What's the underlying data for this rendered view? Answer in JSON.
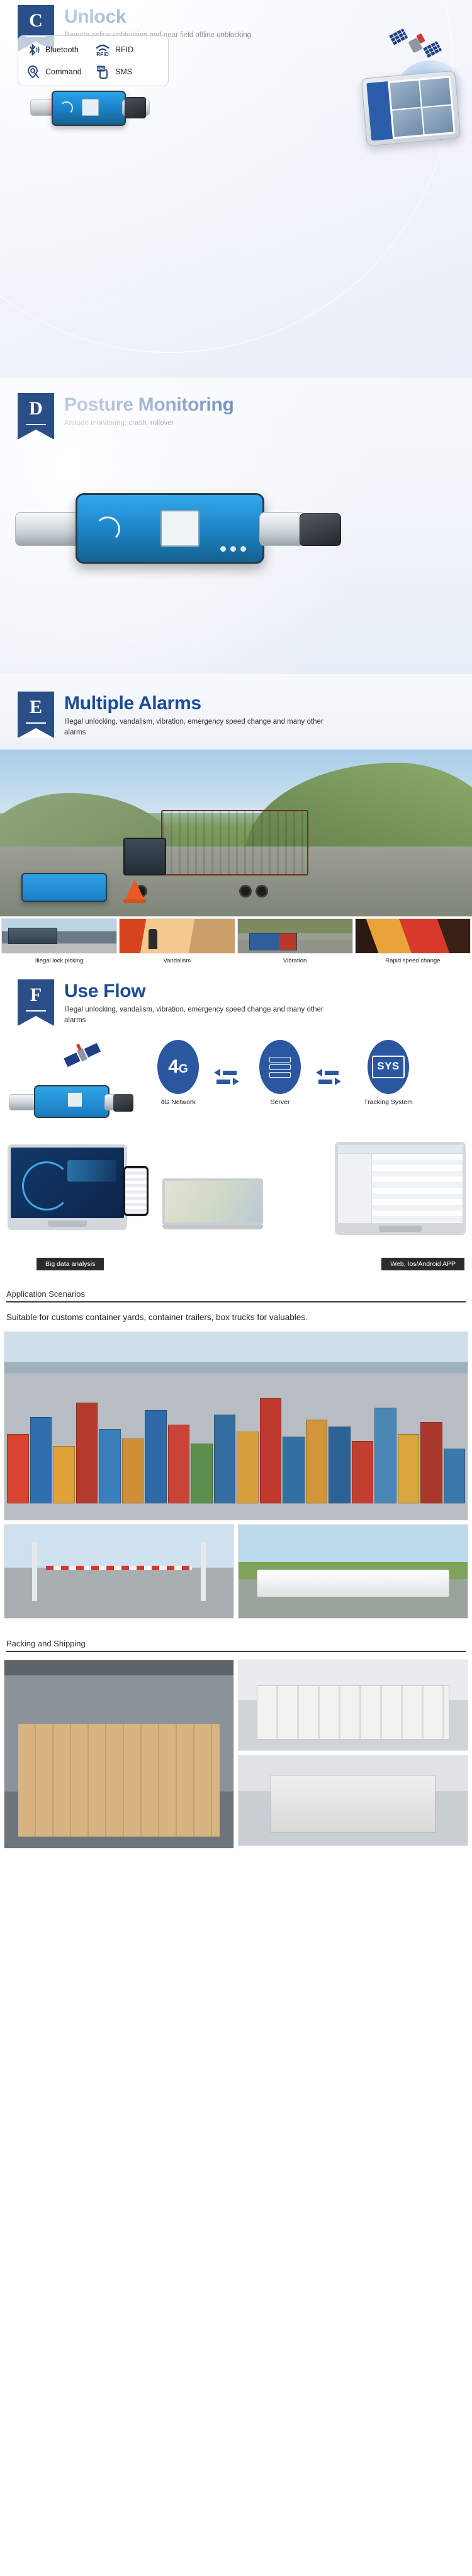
{
  "sections": {
    "unlock": {
      "badge": "C",
      "title": "Unlock",
      "subtitle": "Remote online unblocking and near field offline unblocking",
      "methods": [
        {
          "label": "Bluetooth",
          "icon": "bluetooth-icon"
        },
        {
          "label": "RFID",
          "icon": "rfid-icon"
        },
        {
          "label": "Command",
          "icon": "location-command-icon"
        },
        {
          "label": "SMS",
          "icon": "sms-icon"
        }
      ],
      "rfid_glyph": "RFID",
      "sms_glyph": "SMS"
    },
    "posture": {
      "badge": "D",
      "title": "Posture Monitoring",
      "subtitle": "Attitude monitoring: crash, rollover"
    },
    "alarms": {
      "badge": "E",
      "title": "Multiple Alarms",
      "subtitle": "Illegal unlocking, vandalism, vibration, emergency speed change and many other alarms",
      "thumbnails": [
        {
          "caption": "Illegal lock picking"
        },
        {
          "caption": "Vandalism"
        },
        {
          "caption": "Vibration"
        },
        {
          "caption": "Rapid speed change"
        }
      ]
    },
    "use_flow": {
      "badge": "F",
      "title": "Use Flow",
      "subtitle": "Illegal unlocking, vandalism, vibration, emergency speed change and many other alarms",
      "nodes": [
        {
          "label": "4G Network",
          "glyph": "4",
          "sub_glyph": "G"
        },
        {
          "label": "Server",
          "glyph": ""
        },
        {
          "label": "Tracking System",
          "glyph": "SYS"
        }
      ],
      "screen_captions": [
        "Big data analysis",
        "Web, Ios/Android APP"
      ]
    },
    "application_scenarios": {
      "title": "Application Scenarios",
      "body": "Suitable for customs container yards, container trailers, box trucks for valuables."
    },
    "packing_shipping": {
      "title": "Packing and Shipping"
    }
  },
  "colors": {
    "brand_blue": "#1c4b96",
    "badge_blue": "#2a4f87",
    "node_blue": "#2a57a0",
    "caption_black": "#2b2b2b"
  }
}
